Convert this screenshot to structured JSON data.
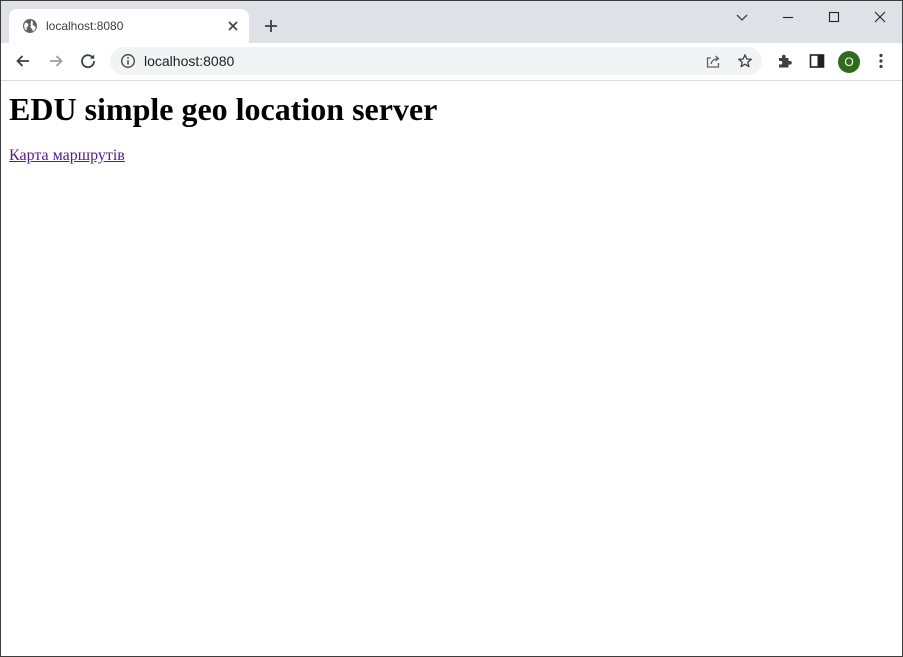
{
  "tab": {
    "title": "localhost:8080",
    "favicon": "globe-icon"
  },
  "window_controls": {
    "tab_search": "chevron-down-icon",
    "minimize": "minimize-icon",
    "maximize": "maximize-icon",
    "close": "close-icon"
  },
  "toolbar": {
    "back": "arrow-left-icon",
    "forward": "arrow-right-icon",
    "reload": "reload-icon",
    "extensions": "puzzle-icon",
    "side_panel": "side-panel-icon",
    "menu": "kebab-menu-icon"
  },
  "omnibox": {
    "url": "localhost:8080",
    "site_info_icon": "info-icon",
    "share_icon": "share-icon",
    "bookmark_icon": "star-icon"
  },
  "profile": {
    "initial": "O",
    "color": "#2e6b1d"
  },
  "page": {
    "heading": "EDU simple geo location server",
    "link_text": "Карта маршрутів",
    "link_color": "#551a8b"
  }
}
